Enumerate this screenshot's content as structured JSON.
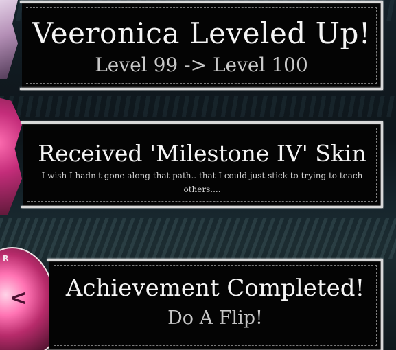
{
  "notifications": [
    {
      "title": "Veeronica Leveled Up!",
      "subtitle": "Level 99 -> Level 100"
    },
    {
      "title": "Received 'Milestone IV' Skin",
      "description": "I wish I hadn't gone along that path.. that I could just stick to trying to teach others...."
    },
    {
      "title": "Achievement Completed!",
      "subtitle": "Do A Flip!"
    }
  ],
  "character": {
    "tag": "R",
    "glyph": "<"
  },
  "colors": {
    "panel_bg": "#040404",
    "panel_border": "#d9d9d9",
    "title_text": "#f5f5f5",
    "subtitle_text": "#c8c8c8",
    "accent_pink": "#ff73b3"
  }
}
